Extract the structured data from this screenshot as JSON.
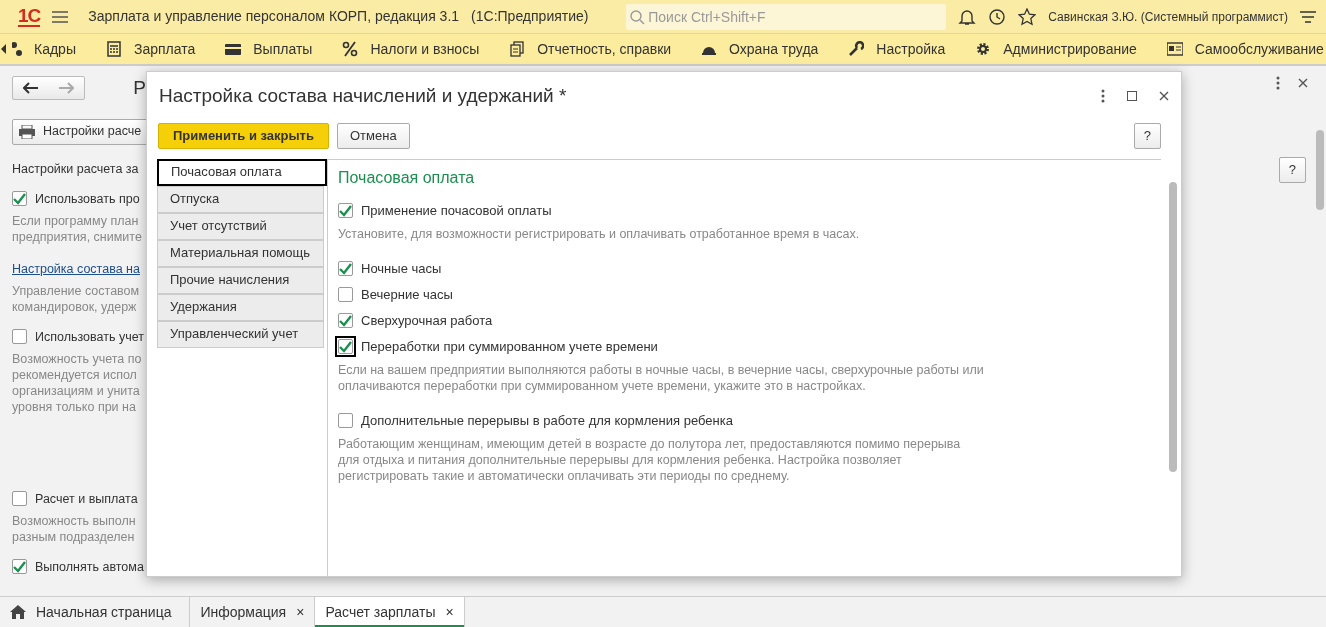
{
  "app": {
    "logo": "1С",
    "title": "Зарплата и управление персоналом КОРП, редакция 3.1",
    "subtitle": "(1С:Предприятие)",
    "search": {
      "placeholder": "Поиск Ctrl+Shift+F"
    },
    "user": "Савинская З.Ю. (Системный программист)"
  },
  "sections": [
    {
      "label": "Кадры"
    },
    {
      "label": "Зарплата"
    },
    {
      "label": "Выплаты"
    },
    {
      "label": "Налоги и взносы"
    },
    {
      "label": "Отчетность, справки"
    },
    {
      "label": "Охрана труда"
    },
    {
      "label": "Настройка"
    },
    {
      "label": "Администрирование"
    },
    {
      "label": "Самообслуживание"
    }
  ],
  "background_page": {
    "title": "Р",
    "print_button": "Настройки расче",
    "help": "?",
    "items": [
      {
        "kind": "text",
        "text": "Настройки расчета за"
      },
      {
        "kind": "checkbox",
        "label": "Использовать про",
        "checked": true
      },
      {
        "kind": "note",
        "lines": [
          "Если программу план",
          "предприятия, снимите"
        ]
      },
      {
        "kind": "link",
        "text": "Настройка состава на"
      },
      {
        "kind": "note",
        "lines": [
          "Управление составом",
          "командировок, удерж"
        ]
      },
      {
        "kind": "checkbox",
        "label": "Использовать учет",
        "checked": false
      },
      {
        "kind": "note",
        "lines": [
          "Возможность учета по",
          "рекомендуется испол",
          "организациям и унита",
          "уровня только при на"
        ]
      },
      {
        "kind": "spacer"
      },
      {
        "kind": "checkbox",
        "label": "Расчет и выплата",
        "checked": false
      },
      {
        "kind": "note",
        "lines": [
          "Возможность выполн",
          "разным подразделен"
        ]
      },
      {
        "kind": "checkbox",
        "label": "Выполнять автома",
        "checked": true
      }
    ]
  },
  "modal": {
    "title": "Настройка состава начислений и удержаний *",
    "buttons": [
      {
        "label": "Применить и закрыть",
        "kind": "primary"
      },
      {
        "label": "Отмена",
        "kind": "default"
      }
    ],
    "help": "?",
    "tabs": [
      {
        "label": "Почасовая оплата",
        "selected": true
      },
      {
        "label": "Отпуска",
        "selected": false
      },
      {
        "label": "Учет отсутствий",
        "selected": false
      },
      {
        "label": "Материальная помощь",
        "selected": false
      },
      {
        "label": "Прочие начисления",
        "selected": false
      },
      {
        "label": "Удержания",
        "selected": false
      },
      {
        "label": "Управленческий учет",
        "selected": false
      }
    ],
    "section_title": "Почасовая оплата",
    "content": [
      {
        "kind": "checkbox",
        "label": "Применение почасовой оплаты",
        "checked": true,
        "focused": false
      },
      {
        "kind": "note",
        "lines": [
          "Установите, для возможности регистрировать и оплачивать отработанное время в часах."
        ]
      },
      {
        "kind": "checkbox",
        "label": "Ночные часы",
        "checked": true,
        "focused": false
      },
      {
        "kind": "checkbox",
        "label": "Вечерние часы",
        "checked": false,
        "focused": false
      },
      {
        "kind": "checkbox",
        "label": "Сверхурочная работа",
        "checked": true,
        "focused": false
      },
      {
        "kind": "checkbox",
        "label": "Переработки при суммированном учете времени",
        "checked": true,
        "focused": true
      },
      {
        "kind": "note",
        "lines": [
          "Если на вашем предприятии выполняются работы в ночные часы, в вечерние часы, сверхурочные работы или",
          "оплачиваются переработки при суммированном учете времени, укажите это в настройках."
        ]
      },
      {
        "kind": "checkbox",
        "label": "Дополнительные перерывы в работе для кормления ребенка",
        "checked": false,
        "focused": false
      },
      {
        "kind": "note",
        "lines": [
          "Работающим женщинам, имеющим детей в возрасте до полутора лет, предоставляются помимо перерыва",
          "для отдыха и питания дополнительные перерывы для кормления ребенка. Настройка позволяет",
          "регистрировать такие и автоматически оплачивать эти периоды по среднему."
        ]
      }
    ]
  },
  "open_windows": [
    {
      "kind": "home",
      "label": "Начальная страница",
      "selected": false
    },
    {
      "kind": "tab",
      "label": "Информация",
      "close": "×",
      "selected": false
    },
    {
      "kind": "tab",
      "label": "Расчет зарплаты",
      "close": "×",
      "selected": true
    }
  ]
}
